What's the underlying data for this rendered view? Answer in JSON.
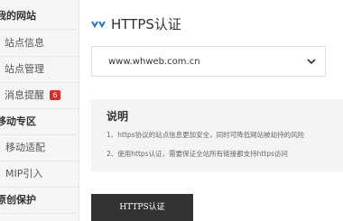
{
  "sidebar": {
    "rows": [
      {
        "kind": "head",
        "label": "我的网站"
      },
      {
        "kind": "item",
        "label": "站点信息"
      },
      {
        "kind": "item",
        "label": "站点管理"
      },
      {
        "kind": "item",
        "label": "消息提醒",
        "badge": "6"
      },
      {
        "kind": "head",
        "label": "移动专区"
      },
      {
        "kind": "item",
        "label": "移动适配"
      },
      {
        "kind": "item",
        "label": "MIP引入"
      },
      {
        "kind": "head",
        "label": "原创保护"
      }
    ]
  },
  "main": {
    "title": "HTTPS认证",
    "domain_select": {
      "value": "www.whweb.com.cn"
    },
    "notice": {
      "title": "说明",
      "lines": [
        "1、https协议的站点信息更加安全，同时可降低网站被劫持的风险",
        "2、使用https认证，需要保证全站所有链接都支持https访问"
      ]
    },
    "submit_label": "HTTPS认证"
  },
  "colors": {
    "accent": "#1a73d9",
    "button_bg": "#333333",
    "badge": "#e02a2a"
  }
}
